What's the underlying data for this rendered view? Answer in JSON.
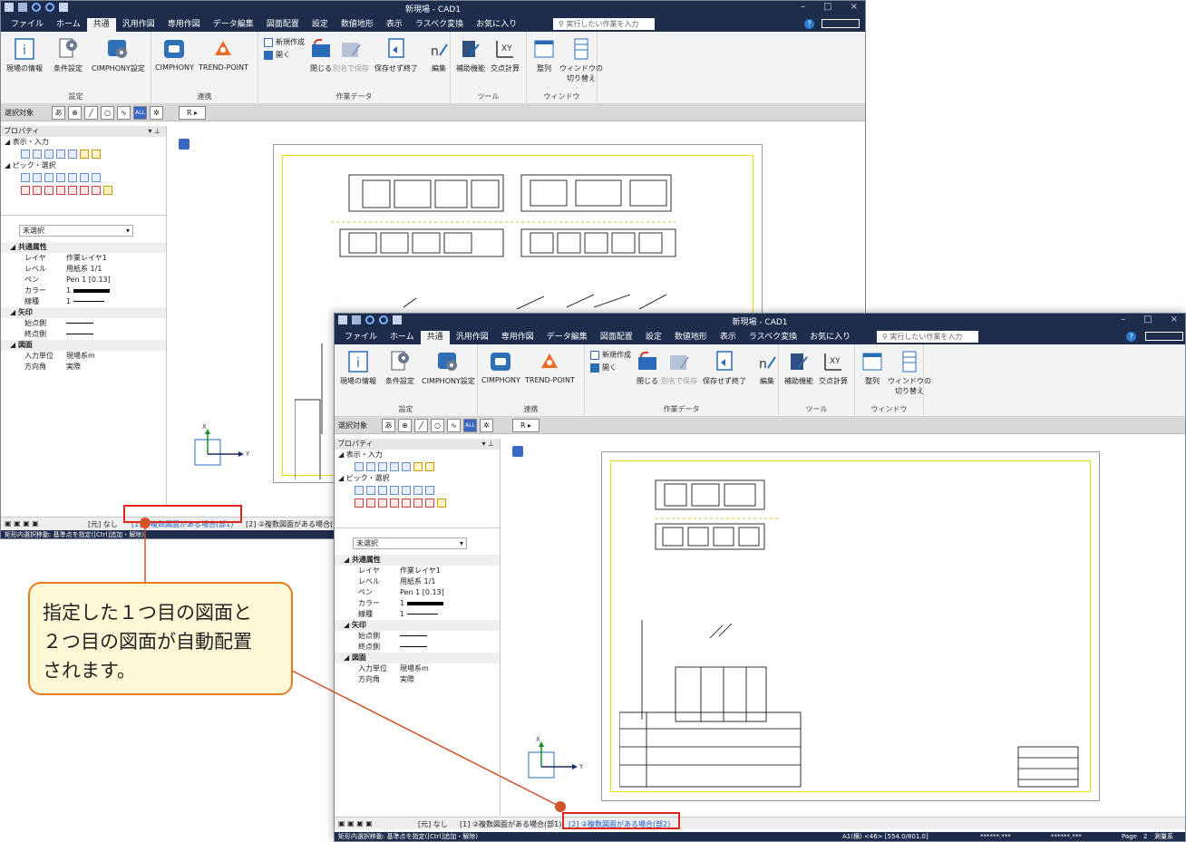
{
  "app": {
    "window_title": "新現場 - CAD1",
    "menu_tabs": [
      "ファイル",
      "ホーム",
      "共通",
      "汎用作図",
      "専用作図",
      "データ編集",
      "図面配置",
      "設定",
      "数値地形",
      "表示",
      "ラスベク変換",
      "お気に入り"
    ],
    "active_tab": "共通",
    "search_placeholder": "実行したい作業を入力",
    "help": "?"
  },
  "ribbon": {
    "settings_group": {
      "label": "設定",
      "site_info": "現場の情報",
      "conditions": "条件設定",
      "cimphony_settings": "CIMPHONY設定"
    },
    "link_group": {
      "label": "連携",
      "cimphony": "CIMPHONY",
      "trend_point": "TREND-POINT"
    },
    "work_data_group": {
      "label": "作業データ",
      "new": "新規作成",
      "open": "開く",
      "close": "閉じる",
      "save_as": "別名で保存",
      "no_save_exit": "保存せず終了",
      "edit": "編集"
    },
    "tools_group": {
      "label": "ツール",
      "assist": "補助機能",
      "intersection": "交点計算"
    },
    "window_group": {
      "label": "ウィンドウ",
      "arrange": "整列",
      "switch_1": "ウィンドウの",
      "switch_2": "切り替え"
    }
  },
  "toolbar": {
    "select_target": "選択対象",
    "btn_a": "あ",
    "btn_all": "ALL",
    "btn_r": "R"
  },
  "panel": {
    "title": "プロパティ",
    "display_input": "表示・入力",
    "pick_select": "ピック・選択",
    "selection": "未選択",
    "categories": {
      "common": "共通属性",
      "arrow": "矢印",
      "drawing": "図面"
    },
    "props": {
      "layer_k": "レイヤ",
      "layer_v": "作業レイヤ1",
      "level_k": "レベル",
      "level_v": "用紙系 1/1",
      "pen_k": "ペン",
      "pen_v": "Pen 1 [0.13]",
      "color_k": "カラー",
      "color_v": "1",
      "linetype_k": "線種",
      "linetype_v": "1",
      "start_k": "始点側",
      "end_k": "終点側",
      "unit_k": "入力単位",
      "unit_v": "現場系m",
      "angle_k": "方向角",
      "angle_v": "実際"
    }
  },
  "axes": {
    "x": "X",
    "y": "Y"
  },
  "tabs": {
    "none": "[元] なし",
    "tab1": "[1] ②複数図面がある場合(部1)",
    "tab2": "[2] ②複数図面がある場合(部2)",
    "tab2_short": "[2] ②複数図面がある場合(部"
  },
  "status": {
    "message": "矩形内選択移動: 基準点を指定([Ctrl]追加・解除)",
    "paper": "A1(横) <46> [554.0/801.0]",
    "coord1": "******.***",
    "coord2": "******.***",
    "page": "Page",
    "page_no": "2",
    "system": "測量系"
  },
  "callout": {
    "line1": "指定した１つ目の図面と",
    "line2": "２つ目の図面が自動配置",
    "line3": "されます。"
  },
  "colors": {
    "title_bg": "#1f2d4d",
    "highlight": "#e1251b",
    "callout_border": "#e87a22",
    "callout_fill": "#fff8d6",
    "frame": "#e8e000"
  }
}
